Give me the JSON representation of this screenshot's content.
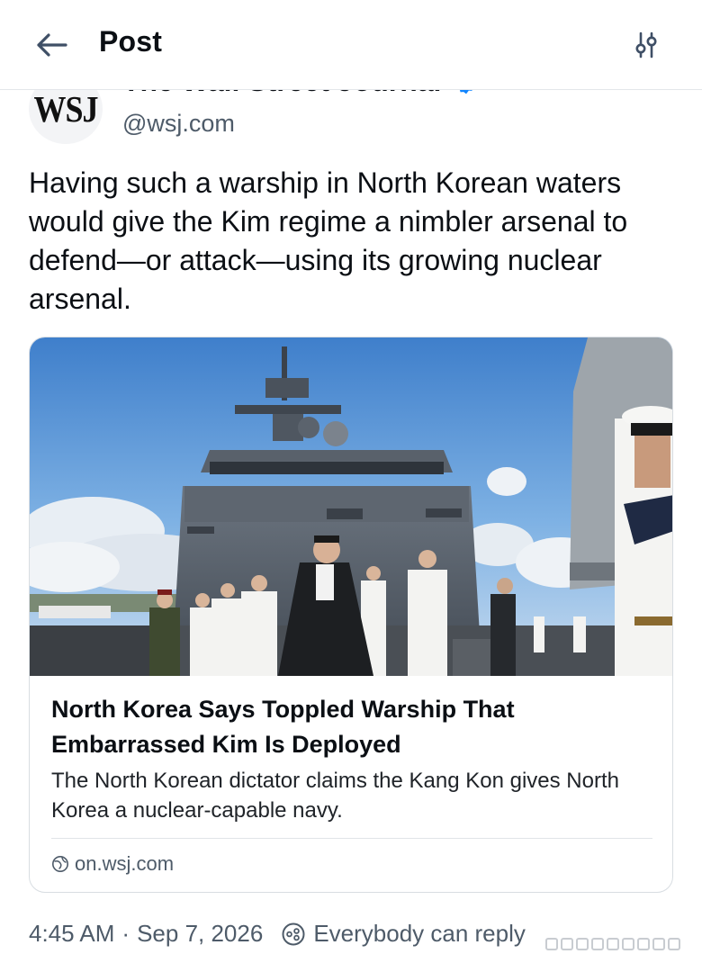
{
  "header": {
    "title": "Post",
    "back_icon": "arrow-left-icon",
    "filter_icon": "sliders-icon"
  },
  "author": {
    "avatar_text": "WSJ",
    "display_name": "The Wall Street Journal",
    "handle": "@wsj.com",
    "verified": true,
    "verified_color": "#1185fe"
  },
  "post": {
    "text": "Having such a warship in North Korean waters would give the Kim regime a nimbler arsenal to defend—or attack—using its growing nuclear arsenal."
  },
  "card": {
    "title": "North Korea Says Toppled Warship That Embarrassed Kim Is Deployed",
    "description": "The North Korean dictator claims the Kang Kon gives North Korea a nuclear-capable navy.",
    "domain": "on.wsj.com",
    "globe_icon": "globe-icon"
  },
  "meta": {
    "time": "4:45 AM",
    "separator": "·",
    "date": "Sep 7, 2026",
    "reply_setting": "Everybody can reply",
    "reply_icon": "reply-settings-icon"
  },
  "colors": {
    "text": "#0b0f14",
    "muted": "#4e5b69",
    "accent": "#1185fe",
    "border": "#d8dde2"
  }
}
